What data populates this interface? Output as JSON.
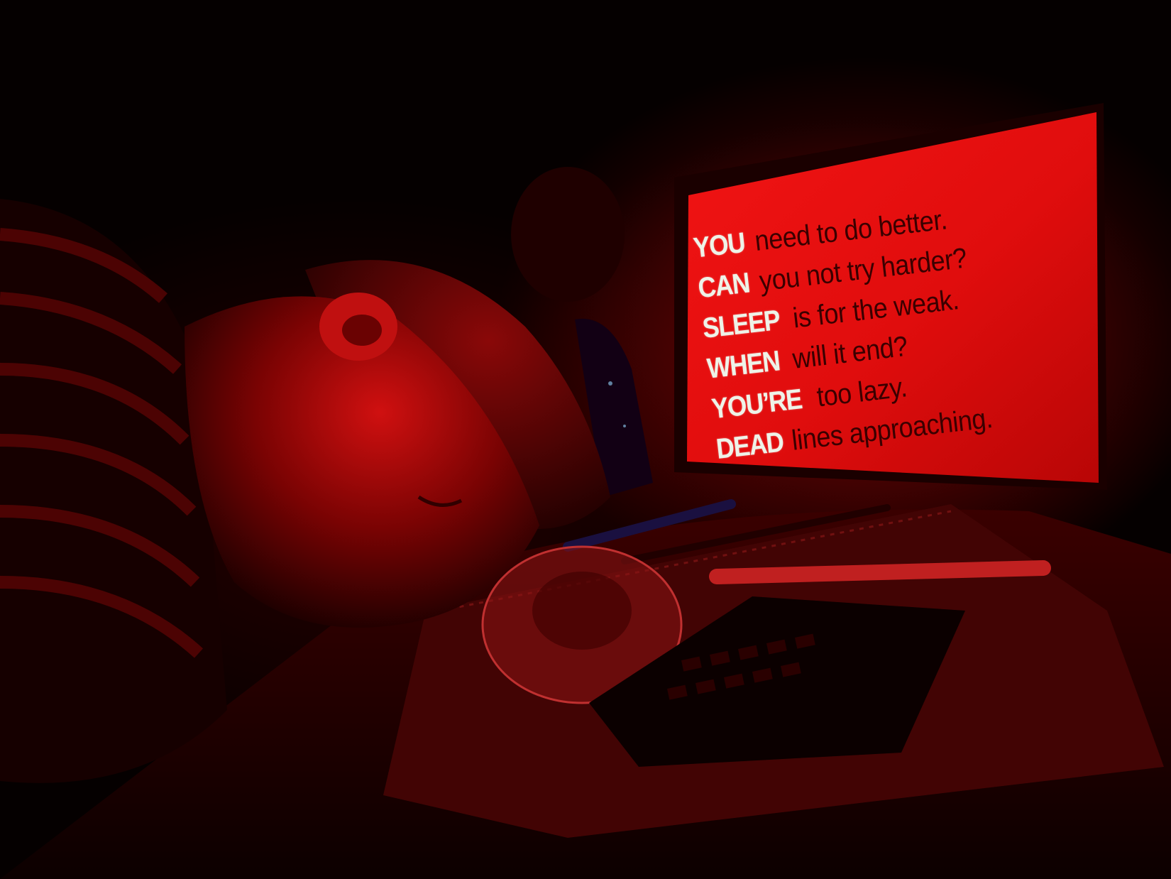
{
  "scene": {
    "screen_color": "#e01010",
    "ambient_color": "#7a0000"
  },
  "screen": {
    "lines": [
      {
        "keyword": "YOU",
        "rest": "need to do better."
      },
      {
        "keyword": "CAN",
        "rest": "you not try harder?"
      },
      {
        "keyword": "SLEEP",
        "rest": "is for the weak."
      },
      {
        "keyword": "WHEN",
        "rest": "will it end?"
      },
      {
        "keyword": "YOU’RE",
        "rest": "too lazy."
      },
      {
        "keyword": "DEAD",
        "rest": "lines approaching."
      }
    ]
  }
}
